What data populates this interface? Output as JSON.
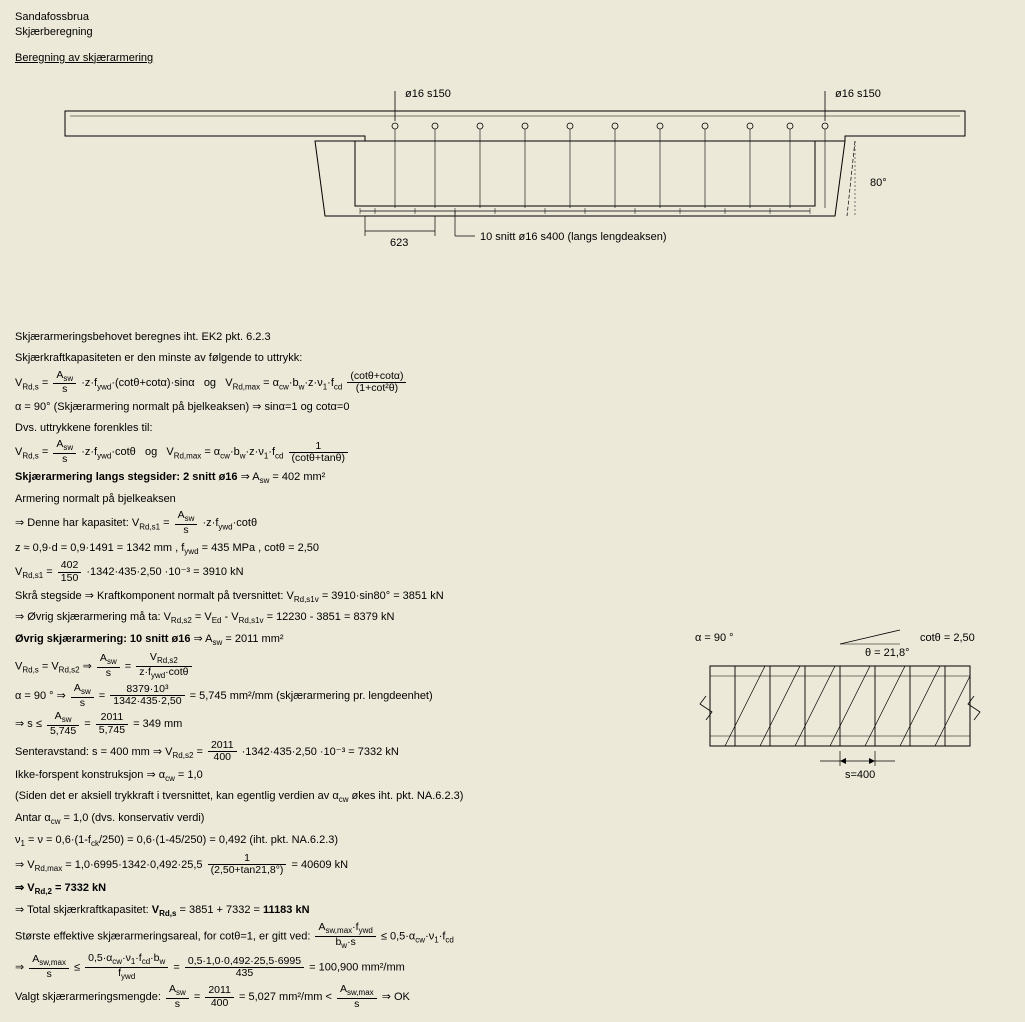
{
  "header": {
    "title1": "Sandafossbrua",
    "title2": "Skjærberegning",
    "section": "Beregning av skjærarmering"
  },
  "diagram": {
    "label_left": "ø16 s150",
    "label_right": "ø16 s150",
    "dim_623": "623",
    "snitt_label": "10 snitt ø16 s400 (langs lengdeaksen)",
    "angle_80": "80°"
  },
  "intro": {
    "l1": "Skjærarmeringsbehovet beregnes iht. EK2 pkt. 6.2.3",
    "l2": "Skjærkraftkapasiteten er den minste av følgende to uttrykk:"
  },
  "eq1": {
    "vrds_lhs": "V",
    "vrds_sub": "Rd,s",
    "eq": " = ",
    "f1n": "A",
    "f1n_sub": "sw",
    "f1d": "s",
    "mid1": "·z·f",
    "ywd": "ywd",
    "mid2": "·(cotθ+cotα)·sinα   og   V",
    "vrdmax_sub": "Rd,max",
    "mid3": " = α",
    "cw": "cw",
    "mid4": "·b",
    "w": "w",
    "mid4b": "·z·ν",
    "one": "1",
    "mid4c": "·f",
    "cd": "cd",
    "f2n": "(cotθ+cotα)",
    "f2d": "(1+cot²θ)"
  },
  "alpha90": "α = 90° (Skjærarmering normalt på bjelkeaksen) ⇒ sinα=1 og cotα=0",
  "dvs": "Dvs. uttrykkene forenkles til:",
  "eq2_mid": "·z·f",
  "eq2_mid2": "·cotθ   og   V",
  "eq2_mid3": " = α",
  "eq2_mid4": "·b",
  "eq2_mid4b": "·z·ν",
  "eq2_mid4c": "·f",
  "eq2_f2n": "1",
  "eq2_f2d": "(cotθ+tanθ)",
  "langs": {
    "title": "Skjærarmering langs stegsider:   2 snitt ø16",
    "asw": " ⇒ A",
    "asw_val": " = 402 mm²",
    "l1": "Armering normalt på bjelkeaksen",
    "l2a": "⇒ Denne har kapasitet: V",
    "l2_sub": "Rd,s1",
    "l2b": " = ",
    "l2c": "·z·f",
    "l2d": "·cotθ",
    "l3": "z ≈ 0,9·d = 0,9·1491 = 1342 mm  ,  f",
    "l3b": " = 435 MPa  ,  cotθ = 2,50",
    "l4a": "V",
    "l4b": " = ",
    "l4_fn": "402",
    "l4_fd": "150",
    "l4c": "·1342·435·2,50 ·10⁻³ = 3910 kN",
    "l5": "Skrå stegside ⇒ Kraftkomponent normalt på tversnittet: V",
    "l5_sub": "Rd,s1v",
    "l5b": " = 3910·sin80° = 3851 kN",
    "l6": "⇒ Øvrig skjærarmering må ta: V",
    "l6_sub": "Rd,s2",
    "l6b": " = V",
    "l6_sub2": "Ed",
    "l6c": " - V",
    "l6d": " = 12230 - 3851 = 8379 kN"
  },
  "ovrig": {
    "title": "Øvrig skjærarmering:  10 snitt ø16",
    "asw": " ⇒ A",
    "asw_val": " = 2011 mm²",
    "l1a": "V",
    "l1b": " = V",
    "l1c": " ⇒ ",
    "l1d": " = ",
    "l1_f2n_a": "V",
    "l1_f2d": "z·f",
    "l1_f2d_b": "·cotθ",
    "l2a": "α = 90 °  ⇒  ",
    "l2b": " = ",
    "l2_f2n": "8379·10³",
    "l2_f2d": "1342·435·2,50",
    "l2c": " = 5,745 mm²/mm (skjærarmering pr. lengdeenhet)",
    "l3a": "⇒ s ≤ ",
    "l3_f1n": "A",
    "l3_f1d": "5,745",
    "l3b": " = ",
    "l3_f2n": "2011",
    "l3_f2d": "5,745",
    "l3c": " = 349 mm",
    "l4a": "Senteravstand: s = 400 mm ⇒  V",
    "l4b": " = ",
    "l4_fn": "2011",
    "l4_fd": "400",
    "l4c": "·1342·435·2,50 ·10⁻³ = 7332 kN",
    "l5": "Ikke-forspent konstruksjon ⇒ α",
    "l5b": " = 1,0",
    "l6": "(Siden det er aksiell trykkraft i tversnittet, kan egentlig verdien av α",
    "l6b": " økes iht. pkt. NA.6.2.3)",
    "l7": "Antar  α",
    "l7b": " = 1,0 (dvs. konservativ verdi)",
    "l8a": "ν",
    "l8b": " = ν = 0,6·(1-f",
    "l8_ck": "ck",
    "l8c": "/250) = 0,6·(1-45/250) = 0,492 (iht. pkt. NA.6.2.3)",
    "l9a": "⇒ V",
    "l9b": " = 1,0·6995·1342·0,492·25,5",
    "l9_fn": "1",
    "l9_fd": "(2,50+tan21,8°)",
    "l9c": " = 40609 kN",
    "res1a": "⇒ V",
    "res1_sub": "Rd,2",
    "res1b": " = 7332 kN",
    "res2a": "⇒   Total skjærkraftkapasitet: ",
    "res2b": "V",
    "res2c": " = 3851 + 7332 = ",
    "res2d": "11183 kN"
  },
  "eff": {
    "l1a": "Største effektive skjærarmeringsareal, for cotθ=1, er gitt ved: ",
    "l1_fn_a": "A",
    "l1_fn_sub": "sw,max",
    "l1_fn_b": "·f",
    "l1_fd": "b",
    "l1_fd_b": "·s",
    "l1b": " ≤ 0,5·α",
    "l1c": "·ν",
    "l1d": "·f",
    "l2a": "⇒ ",
    "l2_f1n": "A",
    "l2_f1d": "s",
    "l2b": " ≤ ",
    "l2_f2n": "0,5·α",
    "l2_f2n_b": "·ν",
    "l2_f2n_c": "·f",
    "l2_f2n_d": "·b",
    "l2_f2d": "f",
    "l2c": " = ",
    "l2_f3n": "0,5·1,0·0,492·25,5·6995",
    "l2_f3d": "435",
    "l2d": " = 100,900 mm²/mm",
    "l3a": "Valgt skjærarmeringsmengde: ",
    "l3_f1n": "A",
    "l3_f1d": "s",
    "l3b": " = ",
    "l3_f2n": "2011",
    "l3_f2d": "400",
    "l3c": " = 5,027 mm²/mm < ",
    "l3d": " ⇒  OK"
  },
  "detail": {
    "alpha": "α = 90 °",
    "theta": "θ = 21,8°",
    "cot": "cotθ = 2,50",
    "s400": "s=400"
  }
}
